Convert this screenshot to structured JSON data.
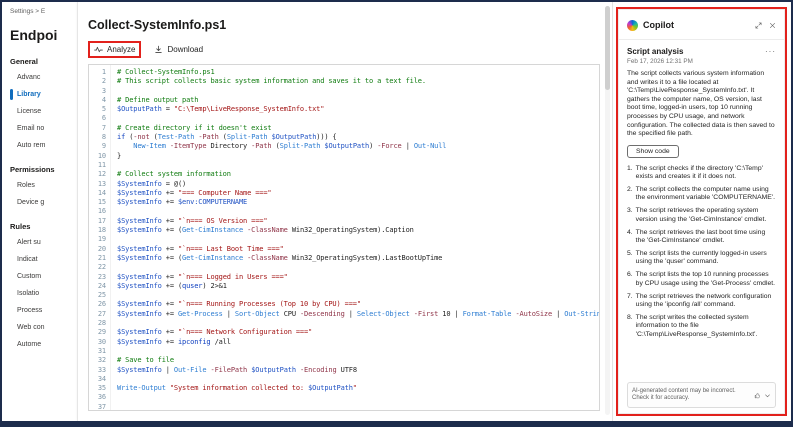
{
  "colors": {
    "annotation_red": "#e2211c",
    "accent_blue": "#0f6cbd",
    "code_comment": "#107c10",
    "code_string": "#a31515",
    "code_variable": "#2153c4",
    "code_cmdlet": "#2d7dd2",
    "code_parameter": "#8f3448",
    "code_keyword": "#1041c0"
  },
  "sidebar": {
    "breadcrumb": "Settings > E",
    "title": "Endpoi",
    "active_item": "Library",
    "sections": [
      {
        "label": "General",
        "items": [
          "Advanc",
          "Library",
          "License",
          "Email no",
          "Auto rem"
        ]
      },
      {
        "label": "Permissions",
        "items": [
          "Roles",
          "Device g"
        ]
      },
      {
        "label": "Rules",
        "items": [
          "Alert su",
          "Indicat",
          "Custom",
          "Isolatio",
          "Process",
          "Web con",
          "Autome"
        ]
      }
    ]
  },
  "main": {
    "title": "Collect-SystemInfo.ps1",
    "toolbar": {
      "analyze_label": "Analyze",
      "download_label": "Download"
    },
    "code": {
      "lines": [
        "# Collect-SystemInfo.ps1",
        "# This script collects basic system information and saves it to a text file.",
        "",
        "# Define output path",
        "$OutputPath = \"C:\\Temp\\LiveResponse_SystemInfo.txt\"",
        "",
        "# Create directory if it doesn't exist",
        "if (-not (Test-Path -Path (Split-Path $OutputPath))) {",
        "    New-Item -ItemType Directory -Path (Split-Path $OutputPath) -Force | Out-Null",
        "}",
        "",
        "# Collect system information",
        "$SystemInfo = @()",
        "$SystemInfo += \"=== Computer Name ===\"",
        "$SystemInfo += $env:COMPUTERNAME",
        "",
        "$SystemInfo += \"`n=== OS Version ===\"",
        "$SystemInfo += (Get-CimInstance -ClassName Win32_OperatingSystem).Caption",
        "",
        "$SystemInfo += \"`n=== Last Boot Time ===\"",
        "$SystemInfo += (Get-CimInstance -ClassName Win32_OperatingSystem).LastBootUpTime",
        "",
        "$SystemInfo += \"`n=== Logged in Users ===\"",
        "$SystemInfo += (quser) 2>&1",
        "",
        "$SystemInfo += \"`n=== Running Processes (Top 10 by CPU) ===\"",
        "$SystemInfo += Get-Process | Sort-Object CPU -Descending | Select-Object -First 10 | Format-Table -AutoSize | Out-String",
        "",
        "$SystemInfo += \"`n=== Network Configuration ===\"",
        "$SystemInfo += ipconfig /all",
        "",
        "# Save to file",
        "$SystemInfo | Out-File -FilePath $OutputPath -Encoding UTF8",
        "",
        "Write-Output \"System information collected to: $OutputPath\"",
        "",
        ""
      ]
    }
  },
  "copilot": {
    "title": "Copilot",
    "heading": "Script analysis",
    "more_label": "···",
    "timestamp": "Feb 17, 2026 12:31 PM",
    "summary": "The script collects various system information and writes it to a file located at 'C:\\Temp\\LiveResponse_SystemInfo.txt'. It gathers the computer name, OS version, last boot time, logged-in users, top 10 running processes by CPU usage, and network configuration. The collected data is then saved to the specified file path.",
    "show_code_label": "Show code",
    "steps": [
      "The script checks if the directory 'C:\\Temp' exists and creates it if it does not.",
      "The script collects the computer name using the environment variable 'COMPUTERNAME'.",
      "The script retrieves the operating system version using the 'Get-CimInstance' cmdlet.",
      "The script retrieves the last boot time using the 'Get-CimInstance' cmdlet.",
      "The script lists the currently logged-in users using the 'quser' command.",
      "The script lists the top 10 running processes by CPU usage using the 'Get-Process' cmdlet.",
      "The script retrieves the network configuration using the 'ipconfig /all' command.",
      "The script writes the collected system information to the file 'C:\\Temp\\LiveResponse_SystemInfo.txt'."
    ],
    "disclaimer": "AI-generated content may be incorrect. Check it for accuracy."
  }
}
